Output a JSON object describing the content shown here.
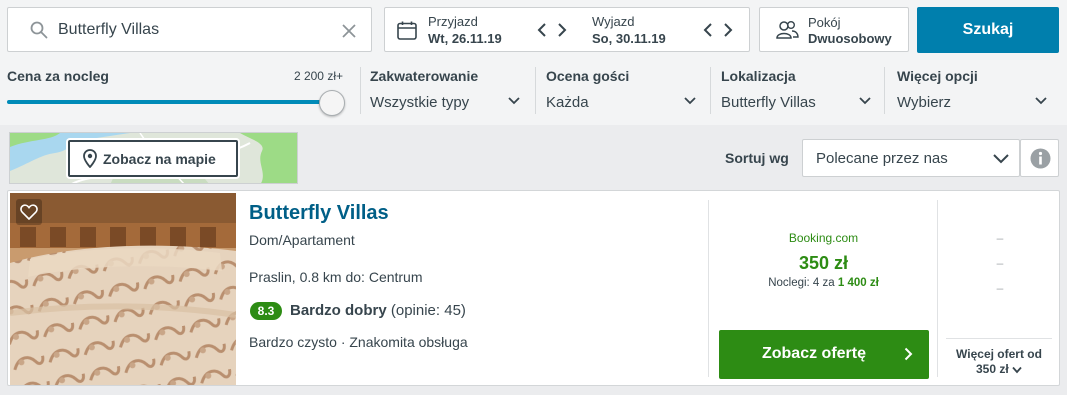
{
  "search": {
    "value": "Butterfly Villas",
    "clear_icon": "close-icon"
  },
  "dates": {
    "checkin_label": "Przyjazd",
    "checkin_value": "Wt, 26.11.19",
    "checkout_label": "Wyjazd",
    "checkout_value": "So, 30.11.19"
  },
  "rooms": {
    "label": "Pokój",
    "value": "Dwuosobowy"
  },
  "search_button": "Szukaj",
  "filters": {
    "price": {
      "title": "Cena za nocleg",
      "max": "2 200 zł+",
      "level": 1.0
    },
    "accommodation": {
      "title": "Zakwaterowanie",
      "value": "Wszystkie typy"
    },
    "rating": {
      "title": "Ocena gości",
      "value": "Każda"
    },
    "location": {
      "title": "Lokalizacja",
      "value": "Butterfly Villas"
    },
    "more": {
      "title": "Więcej opcji",
      "value": "Wybierz"
    }
  },
  "map_button": "Zobacz na mapie",
  "sort": {
    "label": "Sortuj wg",
    "value": "Polecane przez nas"
  },
  "result": {
    "name": "Butterfly Villas",
    "type": "Dom/Apartament",
    "location": "Praslin, 0.8 km do: Centrum",
    "rating_score": "8.3",
    "rating_label": "Bardzo dobry",
    "rating_count": "(opinie: 45)",
    "features": "Bardzo czysto · Znakomita obsługa",
    "partner": "Booking.com",
    "price": "350 zł",
    "nights_text": "Noclegi: 4 za",
    "nights_total": "1 400 zł",
    "offer_button": "Zobacz ofertę",
    "alt_prices": [
      "–",
      "–",
      "–"
    ],
    "more_offers_line1": "Więcej ofert od",
    "more_offers_line2": "350 zł"
  },
  "colors": {
    "primary": "#007fad",
    "deal_green": "#2d8c14",
    "hotel_link": "#005f87",
    "text": "#37454d"
  }
}
